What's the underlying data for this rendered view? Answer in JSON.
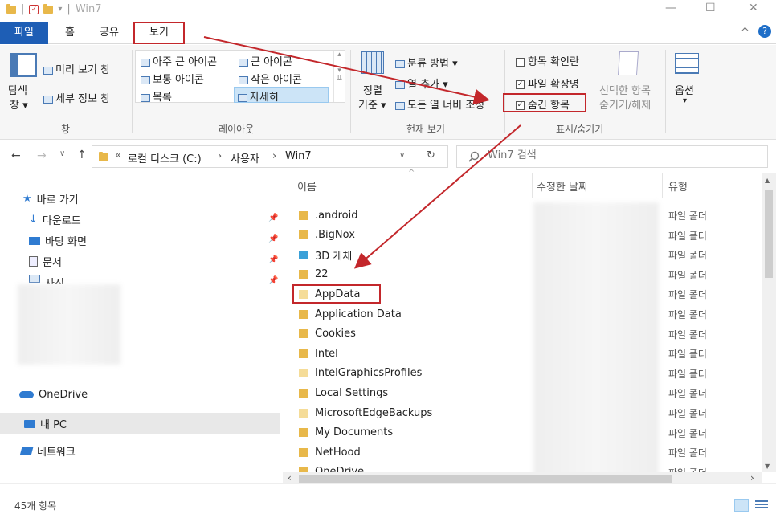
{
  "window": {
    "title": "Win7",
    "qat_separator": "|",
    "qat_dropdown": "▾",
    "minimize": "—",
    "maximize": "☐",
    "close": "✕"
  },
  "tabs": [
    {
      "label": "파일"
    },
    {
      "label": "홈"
    },
    {
      "label": "공유"
    },
    {
      "label": "보기"
    }
  ],
  "ribbon": {
    "help": "?",
    "collapse": "^",
    "pane": {
      "nav_pane_line1": "탐색",
      "nav_pane_line2": "창 ▾",
      "preview": "미리 보기 창",
      "details": "세부 정보 창",
      "label": "창"
    },
    "layout": {
      "items": [
        "아주 큰 아이콘",
        "큰 아이콘",
        "보통 아이콘",
        "작은 아이콘",
        "목록",
        "자세히"
      ],
      "label": "레이아웃"
    },
    "current_view": {
      "sort_line1": "정렬",
      "sort_line2": "기준 ▾",
      "group_by": "분류 방법 ▾",
      "add_columns": "열 추가 ▾",
      "fit_columns": "모든 열 너비 조정",
      "label": "현재 보기"
    },
    "show_hide": {
      "item_checkboxes": "항목 확인란",
      "file_extensions": "파일 확장명",
      "hidden_items": "숨긴 항목",
      "hide_selected_line1": "선택한 항목",
      "hide_selected_line2": "숨기기/해제",
      "label": "표시/숨기기"
    },
    "options": {
      "label": "옵션",
      "arrow": "▾"
    }
  },
  "address": {
    "back": "←",
    "forward": "→",
    "history": "∨",
    "up": "↑",
    "breadcrumb": [
      "로컬 디스크 (C:)",
      "사용자",
      "Win7"
    ],
    "crumb_prefix": "«",
    "crumb_sep": "›",
    "dropdown": "∨",
    "refresh": "↻",
    "search_placeholder": "Win7 검색"
  },
  "nav": {
    "quick_access": "바로 가기",
    "items": [
      {
        "label": "다운로드"
      },
      {
        "label": "바탕 화면"
      },
      {
        "label": "문서"
      },
      {
        "label": "사진"
      }
    ],
    "pin": "📌",
    "onedrive": "OneDrive",
    "this_pc": "내 PC",
    "network": "네트워크"
  },
  "columns": {
    "name": "이름",
    "date": "수정한 날짜",
    "type": "유형",
    "sort_arrow": "^"
  },
  "files": [
    {
      "name": ".android",
      "type": "파일 폴더"
    },
    {
      "name": ".BigNox",
      "type": "파일 폴더"
    },
    {
      "name": "3D 개체",
      "type": "파일 폴더"
    },
    {
      "name": "22",
      "type": "파일 폴더"
    },
    {
      "name": "AppData",
      "type": "파일 폴더"
    },
    {
      "name": "Application Data",
      "type": "파일 폴더"
    },
    {
      "name": "Cookies",
      "type": "파일 폴더"
    },
    {
      "name": "Intel",
      "type": "파일 폴더"
    },
    {
      "name": "IntelGraphicsProfiles",
      "type": "파일 폴더"
    },
    {
      "name": "Local Settings",
      "type": "파일 폴더"
    },
    {
      "name": "MicrosoftEdgeBackups",
      "type": "파일 폴더"
    },
    {
      "name": "My Documents",
      "type": "파일 폴더"
    },
    {
      "name": "NetHood",
      "type": "파일 폴더"
    },
    {
      "name": "OneDrive",
      "type": "파일 폴더"
    }
  ],
  "scroll": {
    "up": "▲",
    "down": "▼",
    "left": "‹",
    "right": "›"
  },
  "status": {
    "count": "45개 항목"
  },
  "colors": {
    "accent": "#1e5eb5",
    "highlight": "#c3272b",
    "folder": "#e8b84a"
  }
}
